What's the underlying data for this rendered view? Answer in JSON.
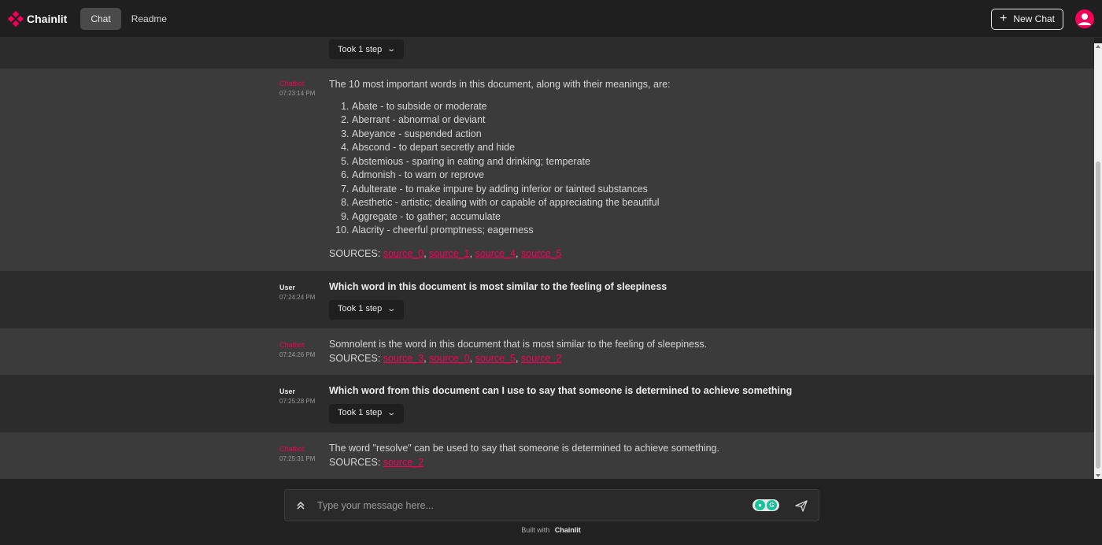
{
  "header": {
    "brand": "Chainlit",
    "tabs": [
      {
        "label": "Chat",
        "active": true
      },
      {
        "label": "Readme",
        "active": false
      }
    ],
    "new_chat_label": "New Chat",
    "accent": "#f50057"
  },
  "messages": {
    "top_step_label": "Took 1 step",
    "m1": {
      "author": "Chatbot",
      "time": "07:23:14 PM",
      "intro": "The 10 most important words in this document, along with their meanings, are:",
      "list": [
        "Abate - to subside or moderate",
        "Aberrant - abnormal or deviant",
        "Abeyance - suspended action",
        "Abscond - to depart secretly and hide",
        "Abstemious - sparing in eating and drinking; temperate",
        "Admonish - to warn or reprove",
        "Adulterate - to make impure by adding inferior or tainted substances",
        "Aesthetic - artistic; dealing with or capable of appreciating the beautiful",
        "Aggregate - to gather; accumulate",
        "Alacrity - cheerful promptness; eagerness"
      ],
      "sources_label": "SOURCES:",
      "sources": [
        "source_0",
        "source_1",
        "source_4",
        "source_5"
      ]
    },
    "m2": {
      "author": "User",
      "time": "07:24:24 PM",
      "text": "Which word in this document is most similar to the feeling of sleepiness",
      "step_label": "Took 1 step"
    },
    "m3": {
      "author": "Chatbot",
      "time": "07:24:26 PM",
      "text": "Somnolent is the word in this document that is most similar to the feeling of sleepiness.",
      "sources_label": "SOURCES:",
      "sources": [
        "source_3",
        "source_0",
        "source_5",
        "source_2"
      ]
    },
    "m4": {
      "author": "User",
      "time": "07:25:28 PM",
      "text": "Which word from this document can I use to say that someone is determined to achieve something",
      "step_label": "Took 1 step"
    },
    "m5": {
      "author": "Chatbot",
      "time": "07:25:31 PM",
      "text": "The word \"resolve\" can be used to say that someone is determined to achieve something.",
      "sources_label": "SOURCES:",
      "sources": [
        "source_2"
      ]
    }
  },
  "composer": {
    "placeholder": "Type your message here..."
  },
  "footer": {
    "built_with": "Built with",
    "brand": "Chainlit"
  }
}
